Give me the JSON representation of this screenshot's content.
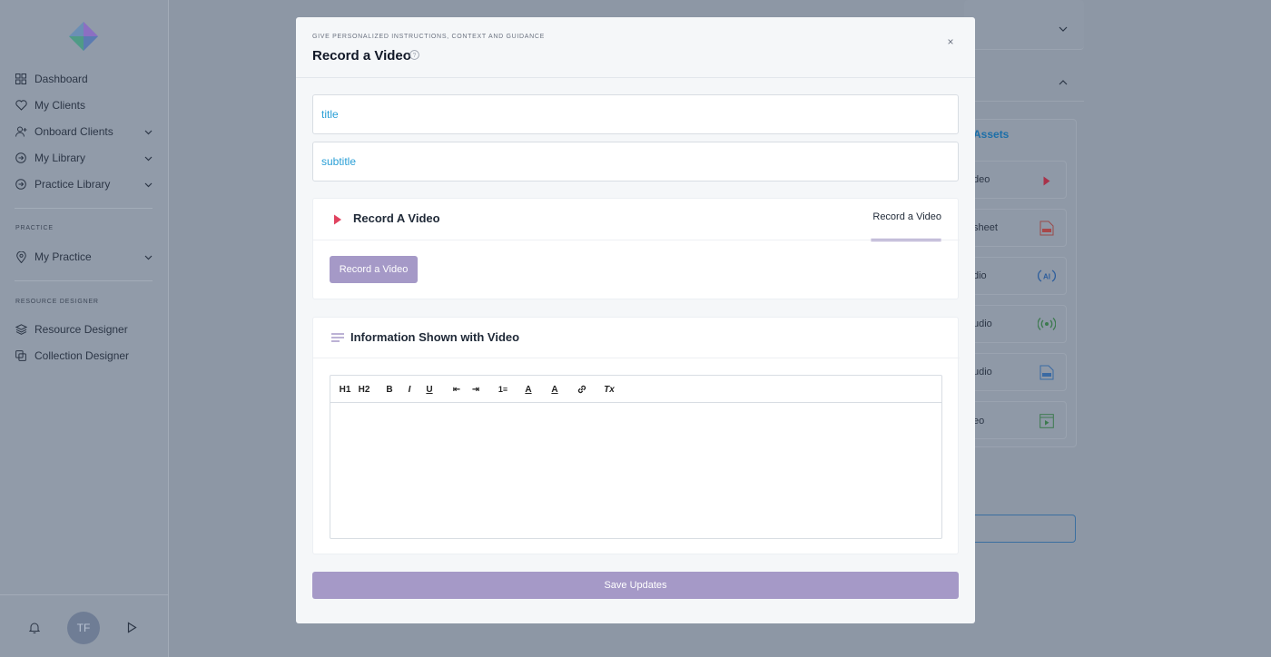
{
  "sidebar": {
    "nav": [
      {
        "label": "Dashboard",
        "icon": "grid-icon"
      },
      {
        "label": "My Clients",
        "icon": "heart-icon"
      },
      {
        "label": "Onboard Clients",
        "icon": "user-plus-icon"
      },
      {
        "label": "My Library",
        "icon": "arrow-circle-icon"
      },
      {
        "label": "Practice Library",
        "icon": "arrow-circle-icon"
      }
    ],
    "practice_label": "PRACTICE",
    "practice_item": "My Practice",
    "designer_label": "RESOURCE DESIGNER",
    "resource_designer": "Resource Designer",
    "collection_designer": "Collection Designer",
    "avatar_initials": "TF"
  },
  "background": {
    "assets_label": "Assets",
    "list": [
      "deo",
      "sheet",
      "dio",
      "udio",
      "udio",
      "eo"
    ]
  },
  "modal": {
    "eyebrow": "GIVE PERSONALIZED INSTRUCTIONS, CONTEXT AND GUIDANCE",
    "title": "Record a Video",
    "close": "×",
    "title_placeholder": "title",
    "subtitle_placeholder": "subtitle",
    "record_section_title": "Record A Video",
    "record_tab": "Record a Video",
    "record_button": "Record a Video",
    "info_section_title": "Information Shown with Video",
    "toolbar": {
      "h1": "H1",
      "h2": "H2",
      "bold": "B",
      "italic": "I",
      "underline": "U",
      "outdent": "⇤",
      "indent": "⇥",
      "ordered_list": "1≡",
      "text_color": "A",
      "highlight": "A",
      "link": "🔗",
      "clear": "Tx"
    },
    "save_button": "Save Updates"
  },
  "colors": {
    "accent": "#a599c7",
    "placeholder_blue": "#2a9fd6",
    "record_red": "#e0425f"
  }
}
